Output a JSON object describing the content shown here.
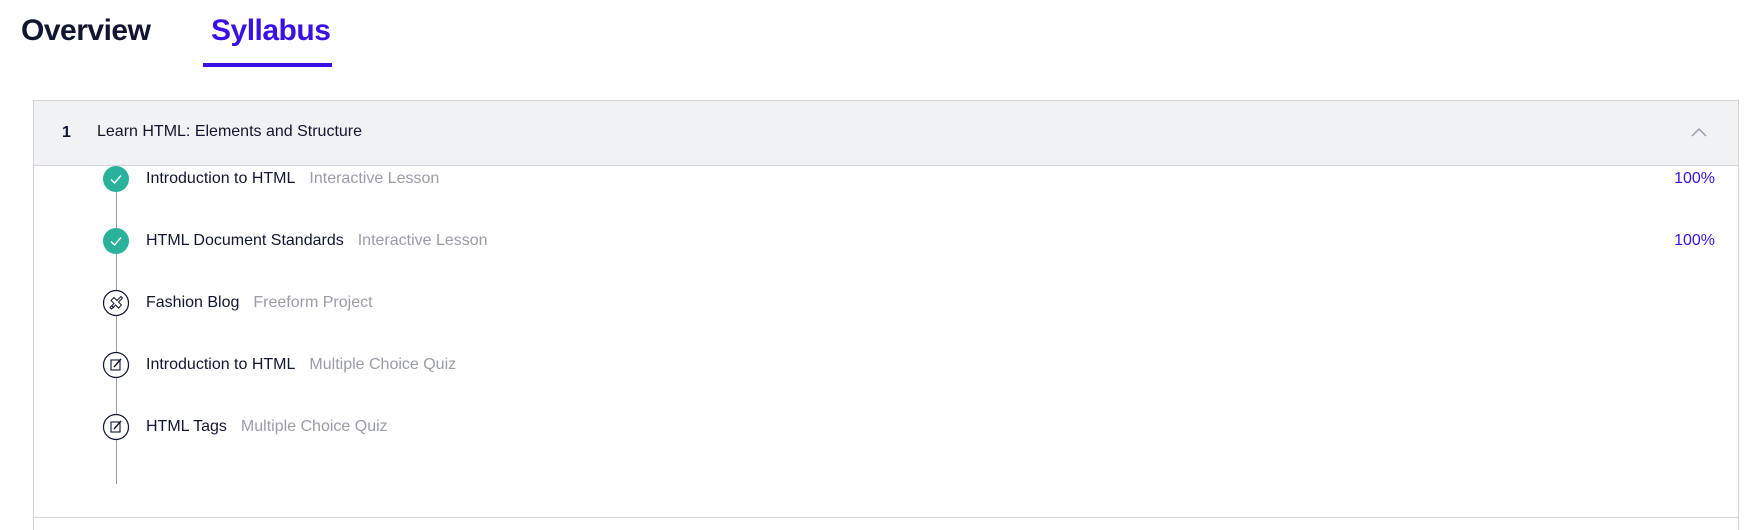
{
  "tabs": {
    "overview": "Overview",
    "syllabus": "Syllabus",
    "active": "syllabus"
  },
  "module": {
    "number": "1",
    "title": "Learn HTML: Elements and Structure",
    "collapse_icon": "chevron-up-icon",
    "items": [
      {
        "name": "Introduction to HTML",
        "type": "Interactive Lesson",
        "progress": "100%",
        "status": "completed",
        "icon": "check-circle-icon"
      },
      {
        "name": "HTML Document Standards",
        "type": "Interactive Lesson",
        "progress": "100%",
        "status": "completed",
        "icon": "check-circle-icon"
      },
      {
        "name": "Fashion Blog",
        "type": "Freeform Project",
        "progress": "",
        "status": "not-started",
        "icon": "project-icon"
      },
      {
        "name": "Introduction to HTML",
        "type": "Multiple Choice Quiz",
        "progress": "",
        "status": "not-started",
        "icon": "quiz-icon"
      },
      {
        "name": "HTML Tags",
        "type": "Multiple Choice Quiz",
        "progress": "",
        "status": "not-started",
        "icon": "quiz-icon"
      }
    ]
  },
  "colors": {
    "accent": "#3a10e5",
    "success": "#29b19b",
    "text": "#10162f",
    "muted": "#9a9ca8",
    "header_bg": "#f1f2f3",
    "border": "#d5d5d8"
  }
}
